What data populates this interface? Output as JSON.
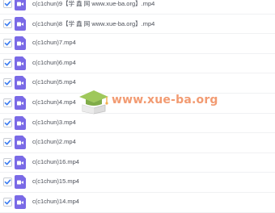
{
  "files": [
    {
      "name": "c(c1chun)9【学 鑫 网 www.xue-ba.org】.mp4",
      "checked": true
    },
    {
      "name": "c(c1chun)8【学 鑫 网 www.xue-ba.org】.mp4",
      "checked": true
    },
    {
      "name": "c(c1chun)7.mp4",
      "checked": true
    },
    {
      "name": "c(c1chun)6.mp4",
      "checked": true
    },
    {
      "name": "c(c1chun)5.mp4",
      "checked": true
    },
    {
      "name": "c(c1chun)4.mp4",
      "checked": true
    },
    {
      "name": "c(c1chun)3.mp4",
      "checked": true
    },
    {
      "name": "c(c1chun)2.mp4",
      "checked": true
    },
    {
      "name": "c(c1chun)16.mp4",
      "checked": true
    },
    {
      "name": "c(c1chun)15.mp4",
      "checked": true
    },
    {
      "name": "c(c1chun)14.mp4",
      "checked": true
    }
  ],
  "watermark": {
    "text": "www.xue-ba.org"
  },
  "colors": {
    "file_icon": "#7a6ae6",
    "checkbox_mark": "#3a7bf0",
    "watermark_text": "#f08a5a"
  },
  "icons": {
    "checkbox": "checkbox-checked-icon",
    "file": "video-file-icon",
    "watermark": "graduation-cap-logo"
  }
}
